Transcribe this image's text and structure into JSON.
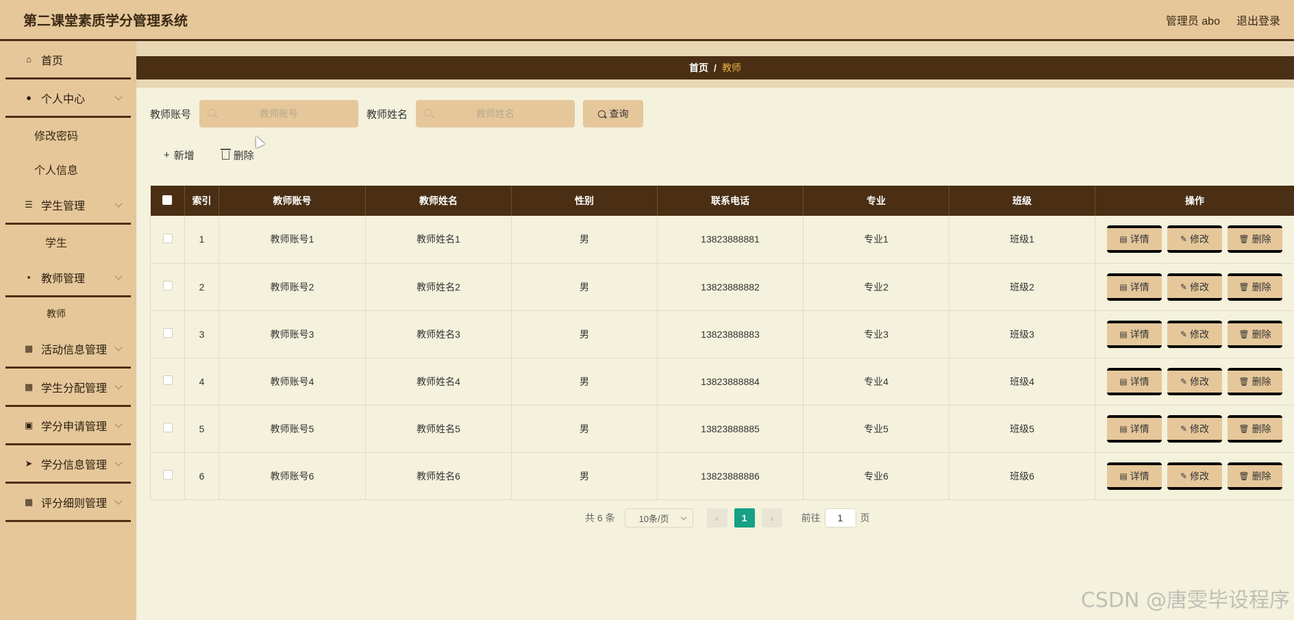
{
  "header": {
    "app_title": "第二课堂素质学分管理系统",
    "user_label": "管理员 abo",
    "logout_label": "退出登录"
  },
  "sidebar": {
    "items": [
      {
        "label": "首页",
        "icon": "home-icon"
      },
      {
        "label": "个人中心",
        "icon": "user-icon"
      },
      {
        "label": "修改密码"
      },
      {
        "label": "个人信息"
      },
      {
        "label": "学生管理",
        "icon": "list-icon"
      },
      {
        "label": "学生"
      },
      {
        "label": "教师管理",
        "icon": "chat-icon"
      },
      {
        "label": "教师"
      },
      {
        "label": "活动信息管理",
        "icon": "grid-icon"
      },
      {
        "label": "学生分配管理",
        "icon": "grid-icon"
      },
      {
        "label": "学分申请管理",
        "icon": "clipboard-icon"
      },
      {
        "label": "学分信息管理",
        "icon": "send-icon"
      },
      {
        "label": "评分细则管理",
        "icon": "grid-icon"
      }
    ]
  },
  "breadcrumb": {
    "home": "首页",
    "sep": "/",
    "current": "教师"
  },
  "search": {
    "account_label": "教师账号",
    "account_placeholder": "教师账号",
    "name_label": "教师姓名",
    "name_placeholder": "教师姓名",
    "query_label": "查询"
  },
  "actions": {
    "add_label": "新增",
    "delete_label": "删除"
  },
  "table": {
    "columns": [
      "索引",
      "教师账号",
      "教师姓名",
      "性别",
      "联系电话",
      "专业",
      "班级",
      "操作"
    ],
    "rows": [
      {
        "index": "1",
        "account": "教师账号1",
        "name": "教师姓名1",
        "gender": "男",
        "phone": "13823888881",
        "major": "专业1",
        "class": "班级1"
      },
      {
        "index": "2",
        "account": "教师账号2",
        "name": "教师姓名2",
        "gender": "男",
        "phone": "13823888882",
        "major": "专业2",
        "class": "班级2"
      },
      {
        "index": "3",
        "account": "教师账号3",
        "name": "教师姓名3",
        "gender": "男",
        "phone": "13823888883",
        "major": "专业3",
        "class": "班级3"
      },
      {
        "index": "4",
        "account": "教师账号4",
        "name": "教师姓名4",
        "gender": "男",
        "phone": "13823888884",
        "major": "专业4",
        "class": "班级4"
      },
      {
        "index": "5",
        "account": "教师账号5",
        "name": "教师姓名5",
        "gender": "男",
        "phone": "13823888885",
        "major": "专业5",
        "class": "班级5"
      },
      {
        "index": "6",
        "account": "教师账号6",
        "name": "教师姓名6",
        "gender": "男",
        "phone": "13823888886",
        "major": "专业6",
        "class": "班级6"
      }
    ],
    "op_detail": "详情",
    "op_edit": "修改",
    "op_delete": "删除"
  },
  "pagination": {
    "total": "共 6 条",
    "page_size": "10条/页",
    "current_page": "1",
    "goto_label": "前往",
    "goto_value": "1",
    "page_suffix": "页"
  },
  "watermark": "CSDN @唐雯毕设程序",
  "colors": {
    "accent": "#e5c79a",
    "dark": "#4a2f14",
    "page_active": "#16a085",
    "breadcrumb_current": "#e8b341"
  }
}
